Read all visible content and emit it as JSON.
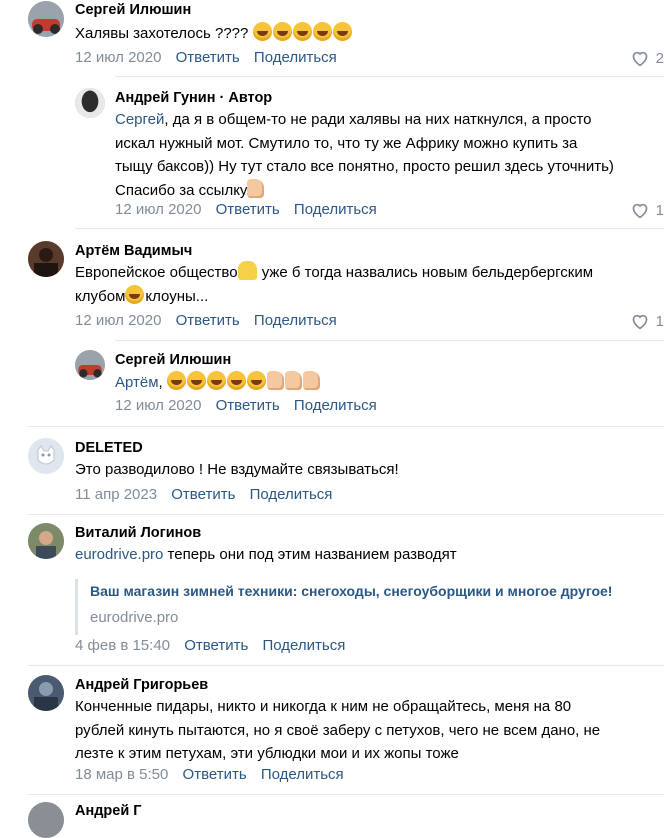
{
  "actions": {
    "reply": "Ответить",
    "share": "Поделиться"
  },
  "comments": [
    {
      "author": "Сергей Илюшин",
      "text": "Халявы захотелось ????",
      "date": "12 июл 2020",
      "likes": "2"
    },
    {
      "author": "Андрей Гунин · Автор",
      "mention": "Сергей",
      "lines": [
        ", да я в общем-то не ради халявы на них наткнулся, а просто",
        "искал нужный мот. Смутило то, что ту же Африку можно купить за",
        "тыщу баксов)) Ну тут стало все понятно, просто решил здесь уточнить)",
        "Спасибо за ссылку"
      ],
      "date": "12 июл 2020",
      "likes": "1"
    },
    {
      "author": "Артём Вадимыч",
      "line1a": "Европейское общество",
      "line1b": " уже б тогда назвались новым бельдербергским",
      "line2a": "клубом",
      "line2b": "клоуны...",
      "date": "12 июл 2020",
      "likes": "1"
    },
    {
      "author": "Сергей Илюшин",
      "mention": "Артём",
      "text": ",",
      "date": "12 июл 2020"
    },
    {
      "author": "DELETED",
      "text": "Это разводилово ! Не вздумайте связываться!",
      "date": "11 апр 2023"
    },
    {
      "author": "Виталий Логинов",
      "link": "eurodrive.pro",
      "text": " теперь они под этим названием разводят",
      "snippet_title": "Ваш магазин зимней техники: снегоходы, снегоуборщики и многое другое!",
      "snippet_domain": "eurodrive.pro",
      "date": "4 фев в 15:40"
    },
    {
      "author": "Андрей Григорьев",
      "lines": [
        "Конченные пидары, никто и никогда к ним не обращайтесь, меня на 80",
        "рублей кинуть пытаются, но я своё заберу с петухов, чего не всем дано, не",
        "лезте к этим петухам, эти ублюдки мои и их жопы тоже"
      ],
      "date": "18 мар в 5:50"
    },
    {
      "author": "Андрей Г"
    }
  ]
}
